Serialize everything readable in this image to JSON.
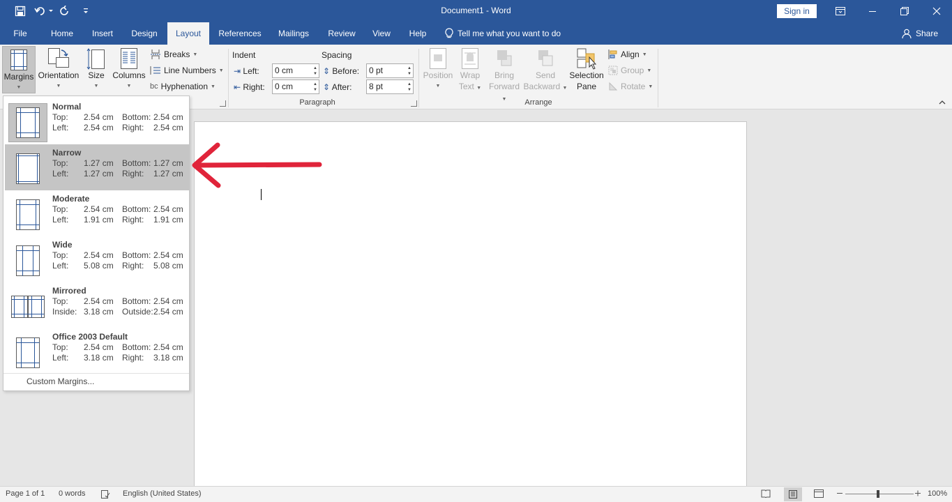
{
  "titlebar": {
    "title": "Document1  -  Word",
    "sign_in": "Sign in"
  },
  "tabs": [
    "File",
    "Home",
    "Insert",
    "Design",
    "Layout",
    "References",
    "Mailings",
    "Review",
    "View",
    "Help"
  ],
  "active_tab": "Layout",
  "tell_me": "Tell me what you want to do",
  "share": "Share",
  "ribbon": {
    "margins": "Margins",
    "orientation": "Orientation",
    "size": "Size",
    "columns": "Columns",
    "breaks": "Breaks",
    "line_numbers": "Line Numbers",
    "hyphenation": "Hyphenation",
    "indent": "Indent",
    "indent_left_label": "Left:",
    "indent_left_value": "0 cm",
    "indent_right_label": "Right:",
    "indent_right_value": "0 cm",
    "spacing": "Spacing",
    "before_label": "Before:",
    "before_value": "0 pt",
    "after_label": "After:",
    "after_value": "8 pt",
    "paragraph_group": "Paragraph",
    "arrange_group": "Arrange",
    "position_1": "Position",
    "wrap_1": "Wrap",
    "wrap_2": "Text",
    "bring_1": "Bring",
    "bring_2": "Forward",
    "send_1": "Send",
    "send_2": "Backward",
    "sel_1": "Selection",
    "sel_2": "Pane",
    "align": "Align",
    "group": "Group",
    "rotate": "Rotate"
  },
  "margins_menu": {
    "items": [
      {
        "name": "Normal",
        "l1a": "Top:",
        "l1b": "2.54 cm",
        "l1c": "Bottom:",
        "l1d": "2.54 cm",
        "l2a": "Left:",
        "l2b": "2.54 cm",
        "l2c": "Right:",
        "l2d": "2.54 cm"
      },
      {
        "name": "Narrow",
        "l1a": "Top:",
        "l1b": "1.27 cm",
        "l1c": "Bottom:",
        "l1d": "1.27 cm",
        "l2a": "Left:",
        "l2b": "1.27 cm",
        "l2c": "Right:",
        "l2d": "1.27 cm"
      },
      {
        "name": "Moderate",
        "l1a": "Top:",
        "l1b": "2.54 cm",
        "l1c": "Bottom:",
        "l1d": "2.54 cm",
        "l2a": "Left:",
        "l2b": "1.91 cm",
        "l2c": "Right:",
        "l2d": "1.91 cm"
      },
      {
        "name": "Wide",
        "l1a": "Top:",
        "l1b": "2.54 cm",
        "l1c": "Bottom:",
        "l1d": "2.54 cm",
        "l2a": "Left:",
        "l2b": "5.08 cm",
        "l2c": "Right:",
        "l2d": "5.08 cm"
      },
      {
        "name": "Mirrored",
        "l1a": "Top:",
        "l1b": "2.54 cm",
        "l1c": "Bottom:",
        "l1d": "2.54 cm",
        "l2a": "Inside:",
        "l2b": "3.18 cm",
        "l2c": "Outside:",
        "l2d": "2.54 cm"
      },
      {
        "name": "Office 2003 Default",
        "l1a": "Top:",
        "l1b": "2.54 cm",
        "l1c": "Bottom:",
        "l1d": "2.54 cm",
        "l2a": "Left:",
        "l2b": "3.18 cm",
        "l2c": "Right:",
        "l2d": "3.18 cm"
      }
    ],
    "custom": "Custom Margins..."
  },
  "status": {
    "page": "Page 1 of 1",
    "words": "0 words",
    "language": "English (United States)",
    "zoom": "100%"
  },
  "colors": {
    "accent": "#2b579a",
    "arrow": "#e0243a"
  }
}
